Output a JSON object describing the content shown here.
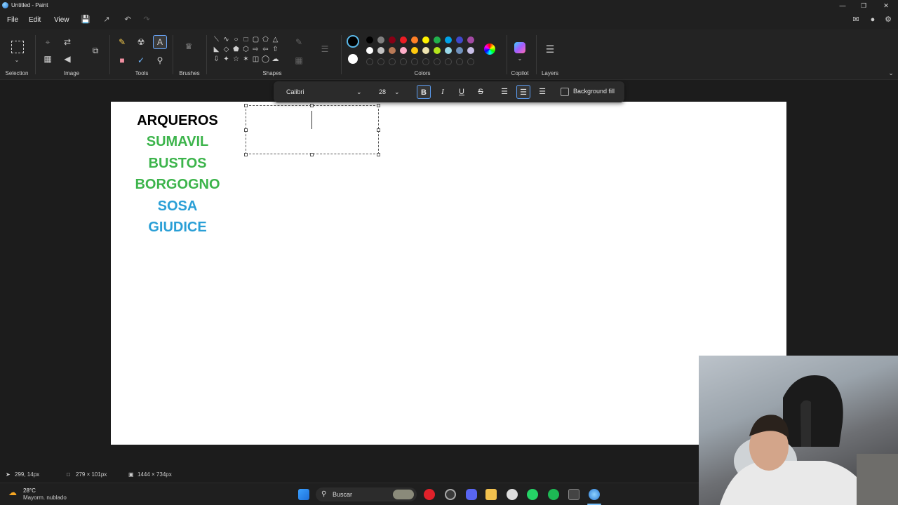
{
  "window": {
    "title": "Untitled - Paint"
  },
  "menu": {
    "file": "File",
    "edit": "Edit",
    "view": "View"
  },
  "ribbon": {
    "groups": {
      "selection": "Selection",
      "image": "Image",
      "tools": "Tools",
      "brushes": "Brushes",
      "shapes": "Shapes",
      "colors": "Colors",
      "copilot": "Copilot",
      "layers": "Layers"
    },
    "palette_row1": [
      "#000000",
      "#7f7f7f",
      "#880015",
      "#ed1c24",
      "#ff7f27",
      "#fff200",
      "#22b14c",
      "#00a2e8",
      "#3f48cc",
      "#a349a4"
    ],
    "palette_row2": [
      "#ffffff",
      "#c3c3c3",
      "#b97a57",
      "#ffaec9",
      "#ffc90e",
      "#efe4b0",
      "#b5e61d",
      "#99d9ea",
      "#7092be",
      "#c8bfe7"
    ]
  },
  "text_toolbar": {
    "font": "Calibri",
    "size": "28",
    "bold": "B",
    "italic": "I",
    "underline": "U",
    "strike": "S",
    "background_fill": "Background fill"
  },
  "canvas_text": {
    "line1": {
      "text": "ARQUEROS",
      "color": "#000000"
    },
    "line2": {
      "text": "SUMAVIL",
      "color": "#3cb44b"
    },
    "line3": {
      "text": "BUSTOS",
      "color": "#3cb44b"
    },
    "line4": {
      "text": "BORGOGNO",
      "color": "#3cb44b"
    },
    "line5": {
      "text": "SOSA",
      "color": "#2a9fd6"
    },
    "line6": {
      "text": "GIUDICE",
      "color": "#2a9fd6"
    }
  },
  "status": {
    "cursor": "299, 14px",
    "selection_size": "279 × 101px",
    "canvas_size": "1444 × 734px"
  },
  "taskbar": {
    "weather_temp": "28°C",
    "weather_desc": "Mayorm. nublado",
    "search_placeholder": "Buscar"
  }
}
